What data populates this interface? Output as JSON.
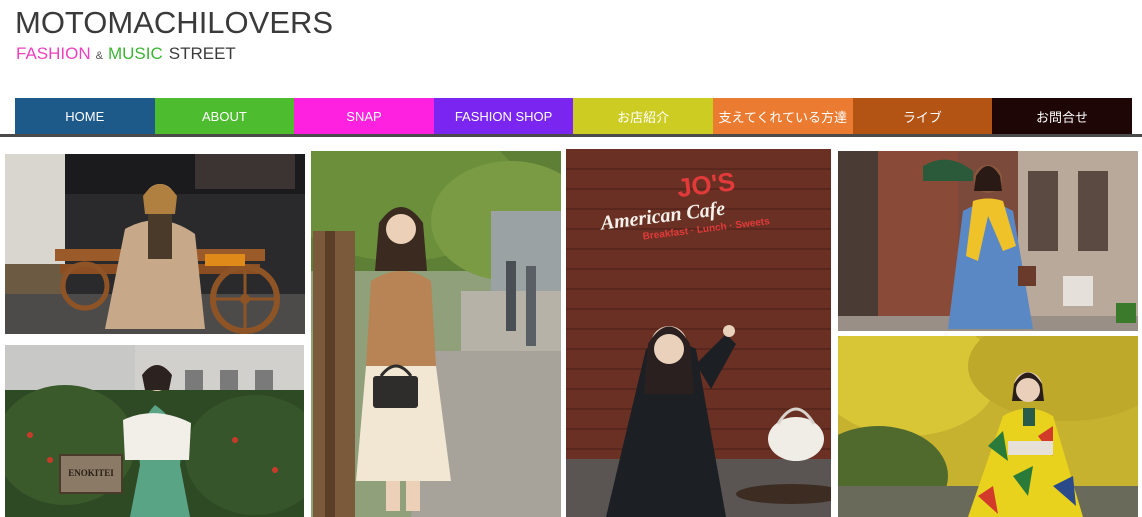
{
  "site": {
    "logo": "MOTOMACHILOVERS",
    "tagline": {
      "fashion": "FASHION",
      "amp": "&",
      "music": "MUSIC",
      "street": "STREET"
    }
  },
  "nav": {
    "items": [
      {
        "label": "HOME",
        "color": "#1d5a8a"
      },
      {
        "label": "ABOUT",
        "color": "#4ebc2f"
      },
      {
        "label": "SNAP",
        "color": "#ff21e0"
      },
      {
        "label": "FASHION SHOP",
        "color": "#7a25f0"
      },
      {
        "label": "お店紹介",
        "color": "#cccc22"
      },
      {
        "label": "支えてくれている方達",
        "color": "#ec7b32"
      },
      {
        "label": "ライブ",
        "color": "#b35414"
      },
      {
        "label": "お問合せ",
        "color": "#1e0606"
      }
    ]
  },
  "photos": {
    "cafe_sign": {
      "line1": "JO'S",
      "line2": "American Cafe",
      "line3": "Breakfast · Lunch · Sweets"
    },
    "restaurant_sign": "ENOKITEI"
  }
}
